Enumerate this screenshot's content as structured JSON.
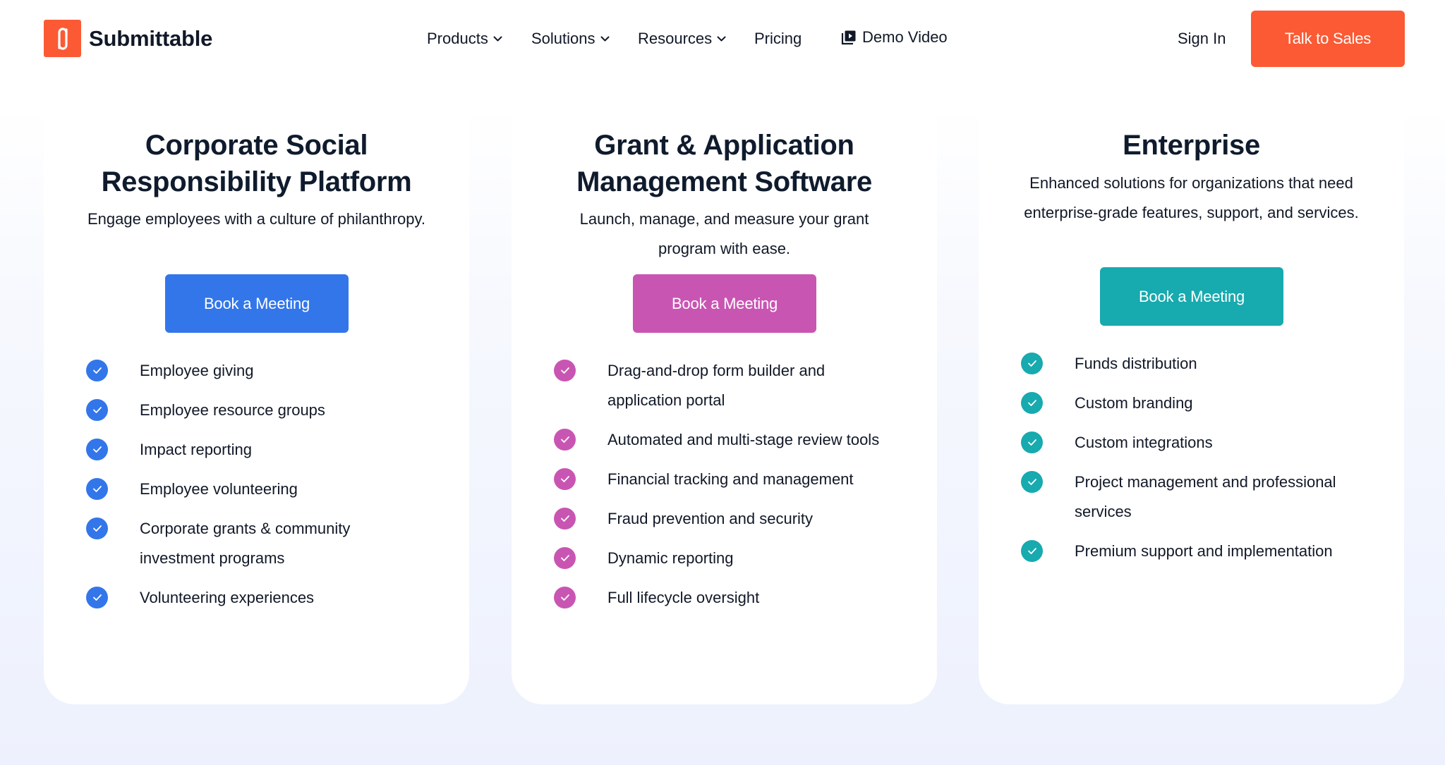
{
  "header": {
    "brand": "Submittable",
    "nav": {
      "products": "Products",
      "solutions": "Solutions",
      "resources": "Resources",
      "pricing": "Pricing",
      "demo_video": "Demo Video"
    },
    "sign_in": "Sign In",
    "cta": "Talk to Sales"
  },
  "colors": {
    "brand_orange": "#fb5a34",
    "csr_blue": "#3276ea",
    "grant_magenta": "#c955b3",
    "enterprise_teal": "#17aaae"
  },
  "cards": [
    {
      "title_line1": "Corporate Social",
      "title_line2": "Responsibility Platform",
      "description": "Engage employees with a culture of philanthropy.",
      "button": "Book a Meeting",
      "features": [
        "Employee giving",
        "Employee resource groups",
        "Impact reporting",
        "Employee volunteering",
        "Corporate grants & community investment programs",
        "Volunteering experiences"
      ]
    },
    {
      "title_line1": "Grant & Application",
      "title_line2": "Management Software",
      "description": "Launch, manage, and measure your grant program with ease.",
      "button": "Book a Meeting",
      "features": [
        "Drag-and-drop form builder and application portal",
        "Automated and multi-stage review tools",
        "Financial tracking and management",
        "Fraud prevention and security",
        "Dynamic reporting",
        "Full lifecycle oversight"
      ]
    },
    {
      "title_line1": "Enterprise",
      "title_line2": "",
      "description": "Enhanced solutions for organizations that need enterprise-grade features, support, and services.",
      "button": "Book a Meeting",
      "features": [
        "Funds distribution",
        "Custom branding",
        "Custom integrations",
        "Project management and professional services",
        "Premium support and implementation"
      ]
    }
  ]
}
